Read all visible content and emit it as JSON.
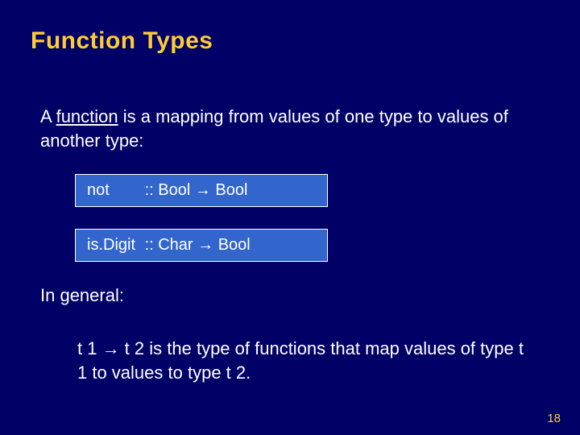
{
  "title": "Function Types",
  "paragraph1_pre": "A ",
  "paragraph1_func": "function",
  "paragraph1_post": " is a mapping from values of one type to values of another type:",
  "code1_name": "not",
  "code1_sig": ":: Bool → Bool",
  "code2_name": "is.Digit",
  "code2_sig": ":: Char → Bool",
  "paragraph2": "In general:",
  "paragraph3": "t 1 → t 2 is the type of functions that map values of type t 1 to values to type t 2.",
  "page_number": "18"
}
